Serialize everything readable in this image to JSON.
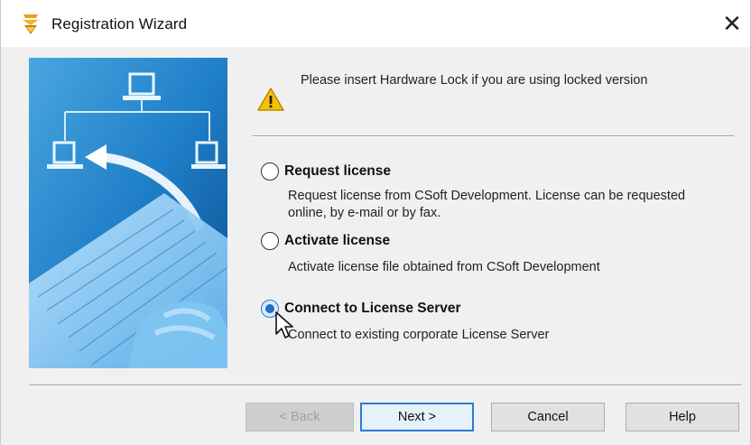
{
  "window": {
    "title": "Registration Wizard",
    "close_glyph": "✕"
  },
  "notice": {
    "icon": "warning-icon",
    "text": "Please insert Hardware Lock if you are using locked version"
  },
  "options": [
    {
      "label": "Request license",
      "description": "Request license from CSoft Development. License can be requested online, by e-mail or by fax.",
      "selected": false
    },
    {
      "label": "Activate license",
      "description": "Activate license file obtained from CSoft Development",
      "selected": false
    },
    {
      "label": "Connect to License Server",
      "description": "Connect to existing corporate License Server",
      "selected": true
    }
  ],
  "buttons": {
    "back": "< Back",
    "next": "Next >",
    "cancel": "Cancel",
    "help": "Help"
  },
  "colors": {
    "accent": "#2a7bd3",
    "image_blue": "#1f7fc8",
    "warning_yellow": "#f5c400"
  }
}
